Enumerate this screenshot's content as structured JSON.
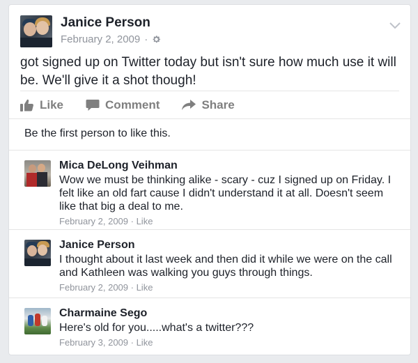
{
  "post": {
    "author": "Janice Person",
    "date": "February 2, 2009",
    "separator": "·",
    "text": "got signed up on Twitter today but isn't sure how much use it will be.  We'll give it a shot though!"
  },
  "actions": {
    "like": "Like",
    "comment": "Comment",
    "share": "Share"
  },
  "likes_summary": "Be the first person to like this.",
  "comments": [
    {
      "name": "Mica DeLong Veihman",
      "text": "Wow we must be thinking alike - scary - cuz I signed up on Friday. I felt like an old fart cause I didn't understand it at all. Doesn't seem like that big a deal to me.",
      "date": "February 2, 2009",
      "like": "Like"
    },
    {
      "name": "Janice Person",
      "text": "I thought about it last week and then did it while we were on the call and Kathleen was walking you guys through things.",
      "date": "February 2, 2009",
      "like": "Like"
    },
    {
      "name": "Charmaine Sego",
      "text": "Here's old for you.....what's a twitter???",
      "date": "February 3, 2009",
      "like": "Like"
    }
  ],
  "meta_separator": " · ",
  "colors": {
    "background": "#e9ebee",
    "card": "#ffffff",
    "text": "#1d2129",
    "muted": "#90949c",
    "action": "#7f7f7f"
  },
  "icons": {
    "settings": "gear-icon",
    "menu": "chevron-down-icon",
    "like": "thumbs-up-icon",
    "comment": "speech-bubble-icon",
    "share": "share-arrow-icon"
  }
}
